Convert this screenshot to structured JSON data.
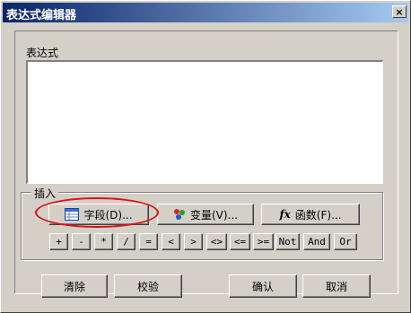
{
  "window": {
    "title": "表达式编辑器",
    "close_glyph": "×"
  },
  "expression": {
    "label": "表达式",
    "value": ""
  },
  "insert": {
    "label": "插入",
    "field_button": "字段(D)...",
    "variable_button": "变量(V)...",
    "function_button": "函数(F)...",
    "function_icon_text": "fx",
    "operators": [
      "+",
      "-",
      "*",
      "/",
      "=",
      "<",
      ">",
      "<>",
      "<=",
      ">=",
      "Not",
      "And",
      "Or"
    ]
  },
  "footer": {
    "clear_button": "清除",
    "validate_button": "校验",
    "ok_button": "确认",
    "cancel_button": "取消"
  },
  "colors": {
    "titlebar_start": "#0a246a",
    "titlebar_end": "#a6caf0",
    "dialog_bg": "#d4d0c8",
    "highlight": "#e01010"
  }
}
